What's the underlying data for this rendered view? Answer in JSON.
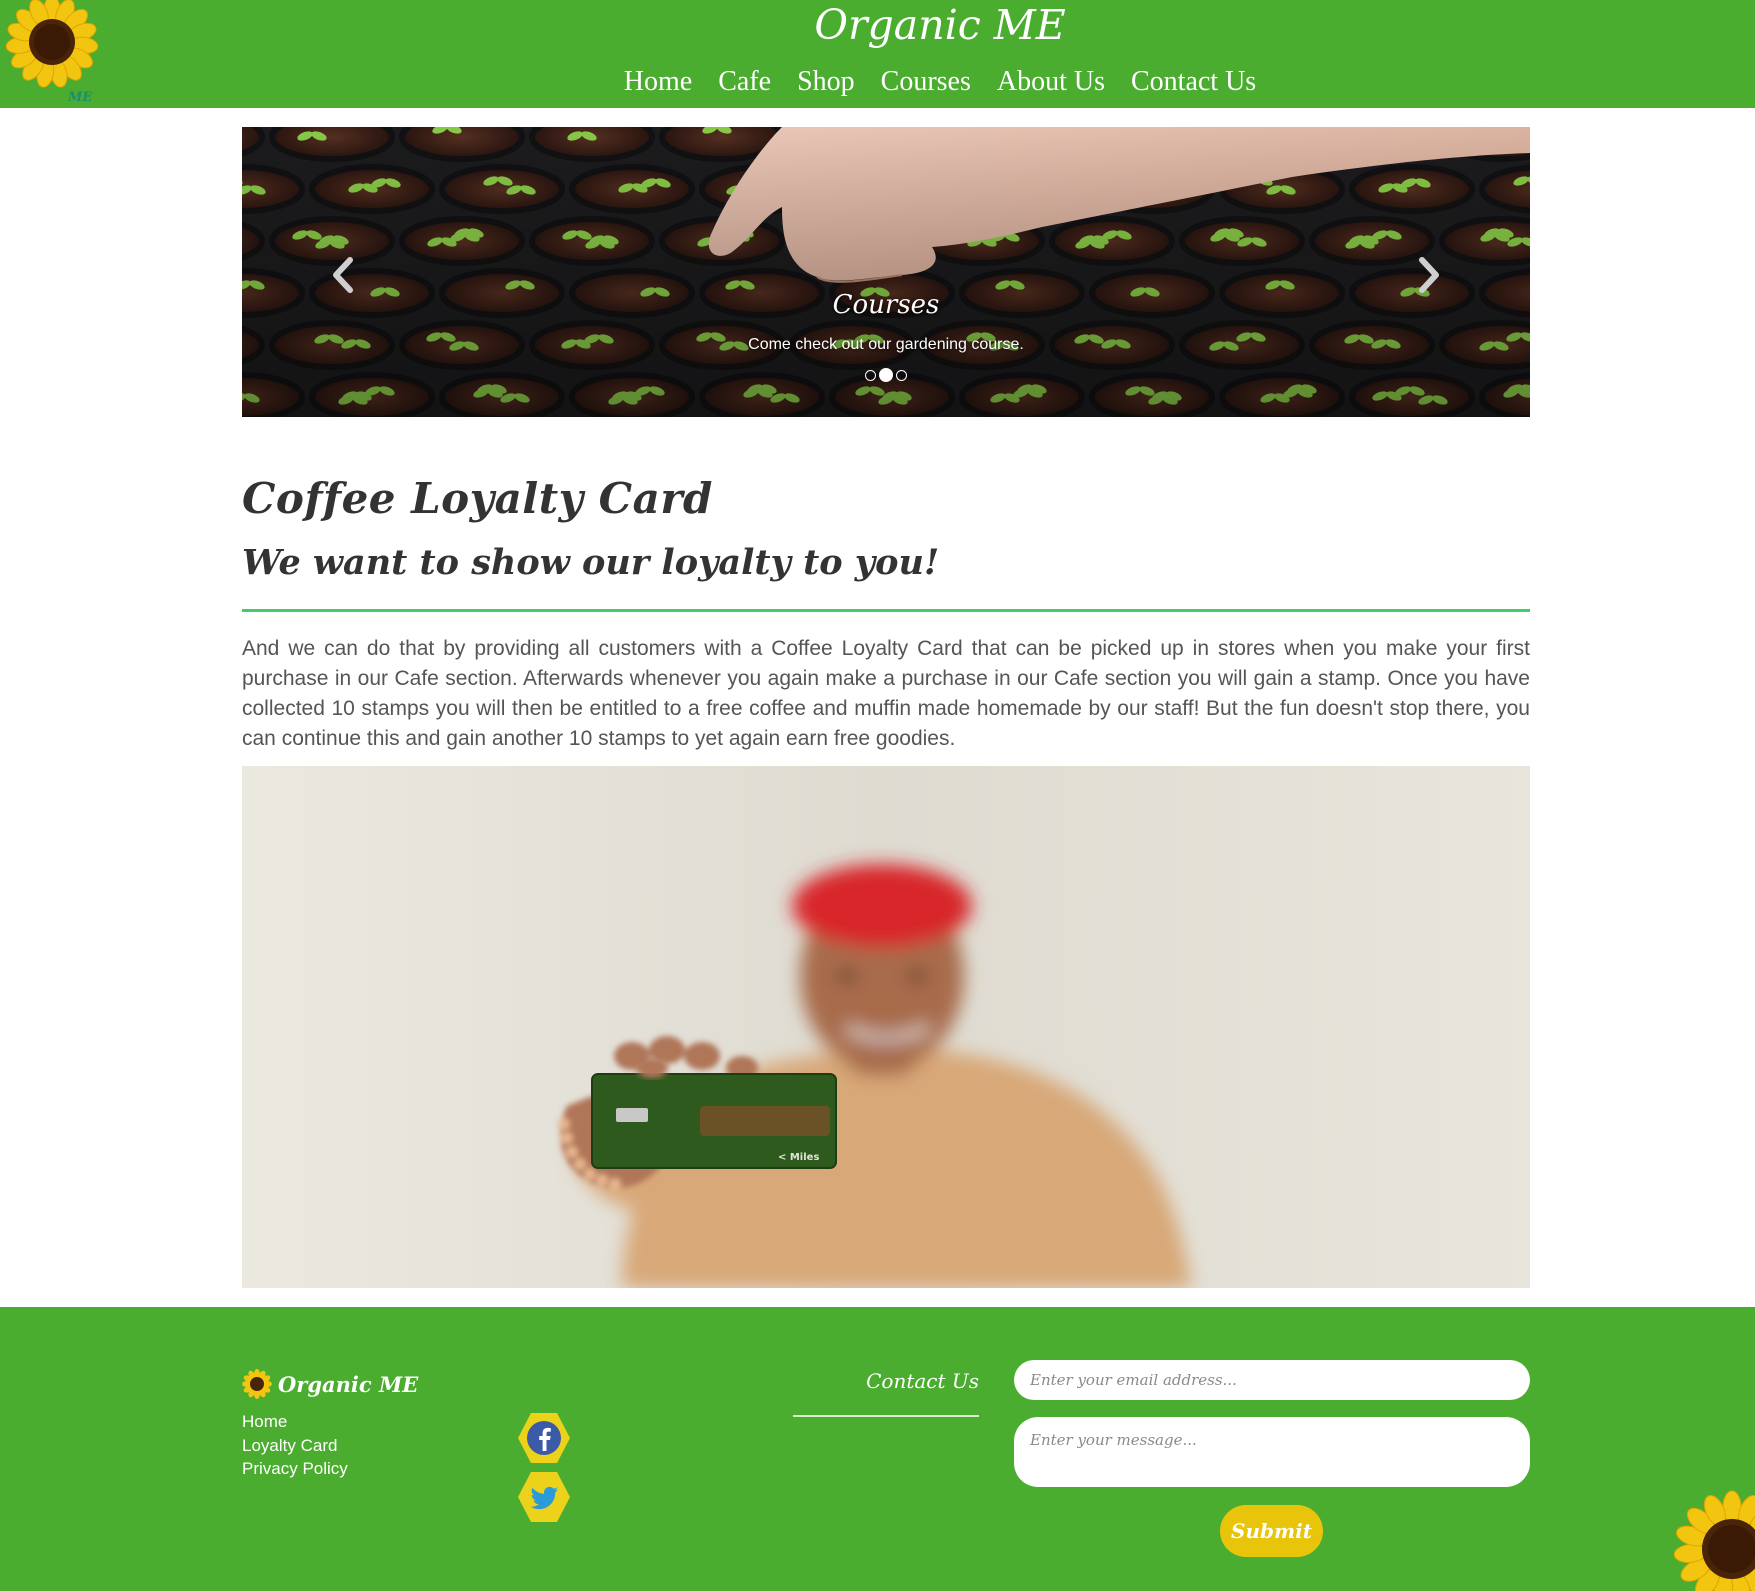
{
  "header": {
    "logo_icon": "sunflower-logo-icon",
    "logo_text": "ME",
    "site_title": "Organic ME",
    "nav": [
      {
        "label": "Home"
      },
      {
        "label": "Cafe"
      },
      {
        "label": "Shop"
      },
      {
        "label": "Courses"
      },
      {
        "label": "About Us"
      },
      {
        "label": "Contact Us"
      }
    ]
  },
  "carousel": {
    "title": "Courses",
    "caption": "Come check out our gardening course.",
    "prev_icon": "chevron-left-icon",
    "next_icon": "chevron-right-icon",
    "slide_count": 3,
    "active_slide": 2
  },
  "main": {
    "heading": "Coffee Loyalty Card",
    "subheading": "We want to show our loyalty to you!",
    "body": "And we can do that by providing all customers with a Coffee Loyalty Card that can be picked up in stores when you make your first purchase in our Cafe section. Afterwards whenever you again make a purchase in our Cafe section you will gain a stamp. Once you have collected 10 stamps you will then be entitled to a free coffee and muffin made homemade by our staff! But the fun doesn't stop there, you can continue this and gain another 10 stamps to yet again earn free goodies.",
    "card_text": "< Miles"
  },
  "footer": {
    "brand": "Organic ME",
    "links": [
      {
        "label": "Home"
      },
      {
        "label": "Loyalty Card"
      },
      {
        "label": "Privacy Policy"
      }
    ],
    "social": [
      {
        "icon": "facebook-icon"
      },
      {
        "icon": "twitter-icon"
      }
    ],
    "contact_label": "Contact Us",
    "email_placeholder": "Enter your email address...",
    "message_placeholder": "Enter your message...",
    "submit_label": "Submit"
  },
  "colors": {
    "brand_green": "#4aad2f",
    "divider_green": "#3fce6a",
    "submit_yellow": "#e8c50a"
  }
}
